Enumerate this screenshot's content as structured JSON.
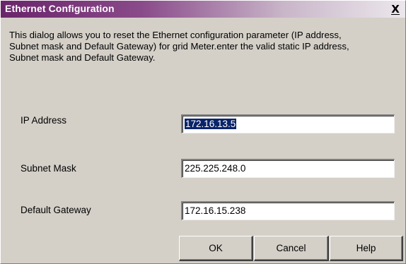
{
  "window": {
    "title": "Ethernet Configuration",
    "close_glyph": "X"
  },
  "description": "This dialog allows you to reset the Ethernet  configuration parameter (IP address,\nSubnet mask and Default Gateway) for grid Meter.enter the valid static IP address,\nSubnet mask and Default Gateway.",
  "fields": {
    "ip_address": {
      "label": "IP Address",
      "value": "172.16.13.5",
      "selected": true
    },
    "subnet_mask": {
      "label": "Subnet Mask",
      "value": "225.225.248.0"
    },
    "default_gateway": {
      "label": "Default Gateway",
      "value": "172.16.15.238"
    }
  },
  "buttons": {
    "ok": "OK",
    "cancel": "Cancel",
    "help": "Help"
  },
  "colors": {
    "title_gradient_start": "#6a246a",
    "dialog_face": "#d4d0c8",
    "selection": "#0a246a"
  },
  "icons": {
    "close": "close-icon"
  }
}
